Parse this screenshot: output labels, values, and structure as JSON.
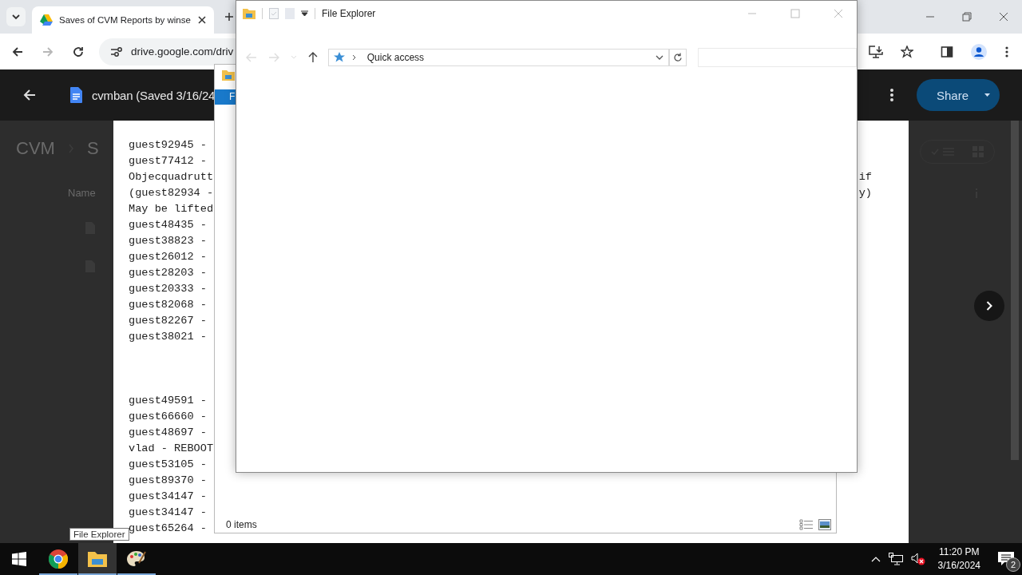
{
  "browser": {
    "tab": {
      "title": "Saves of CVM Reports by winse",
      "selected": true
    },
    "forward_disabled": true,
    "url": "drive.google.com/driv"
  },
  "drive": {
    "doc_title": "cvmban (Saved 3/16/24",
    "share_label": "Share",
    "breadcrumb": [
      "CVM",
      "S"
    ],
    "column_header": "Name"
  },
  "document": {
    "blocks": [
      {
        "lines": [
          {
            "text": "guest92945 -"
          },
          {
            "text": "guest77412 -"
          },
          {
            "text": "Objecquadrutt",
            "tail": "if"
          },
          {
            "text": "(guest82934 -",
            "tail": "y)"
          },
          {
            "text": "May be lifted"
          },
          {
            "text": "guest48435 -"
          },
          {
            "text": "guest38823 -"
          },
          {
            "text": "guest26012 -"
          },
          {
            "text": "guest28203 -"
          },
          {
            "text": "guest20333 -"
          },
          {
            "text": "guest82068 -"
          },
          {
            "text": "guest82267 -"
          },
          {
            "text": "guest38021 -"
          }
        ]
      },
      {
        "lines": [
          {
            "text": "guest49591 -"
          },
          {
            "text": "guest66660 -"
          },
          {
            "text": "guest48697 -"
          },
          {
            "text": "vlad - REBOOT"
          },
          {
            "text": "guest53105 -"
          },
          {
            "text": "guest89370 -"
          },
          {
            "text": "guest34147 -"
          },
          {
            "text": "guest34147 -"
          },
          {
            "text": "guest65264 -"
          }
        ]
      }
    ]
  },
  "explorer_back": {
    "ribbon_tab": "F",
    "status": "0 items"
  },
  "explorer_front": {
    "title": "File Explorer",
    "location": "Quick access"
  },
  "tooltip": "File Explorer",
  "taskbar": {
    "apps": [
      {
        "kind": "chrome",
        "selected": false
      },
      {
        "kind": "explorer",
        "selected": true
      },
      {
        "kind": "paint",
        "selected": false
      }
    ],
    "volume_muted": true,
    "time": "11:20 PM",
    "date": "3/16/2024",
    "notification_count": "2"
  }
}
